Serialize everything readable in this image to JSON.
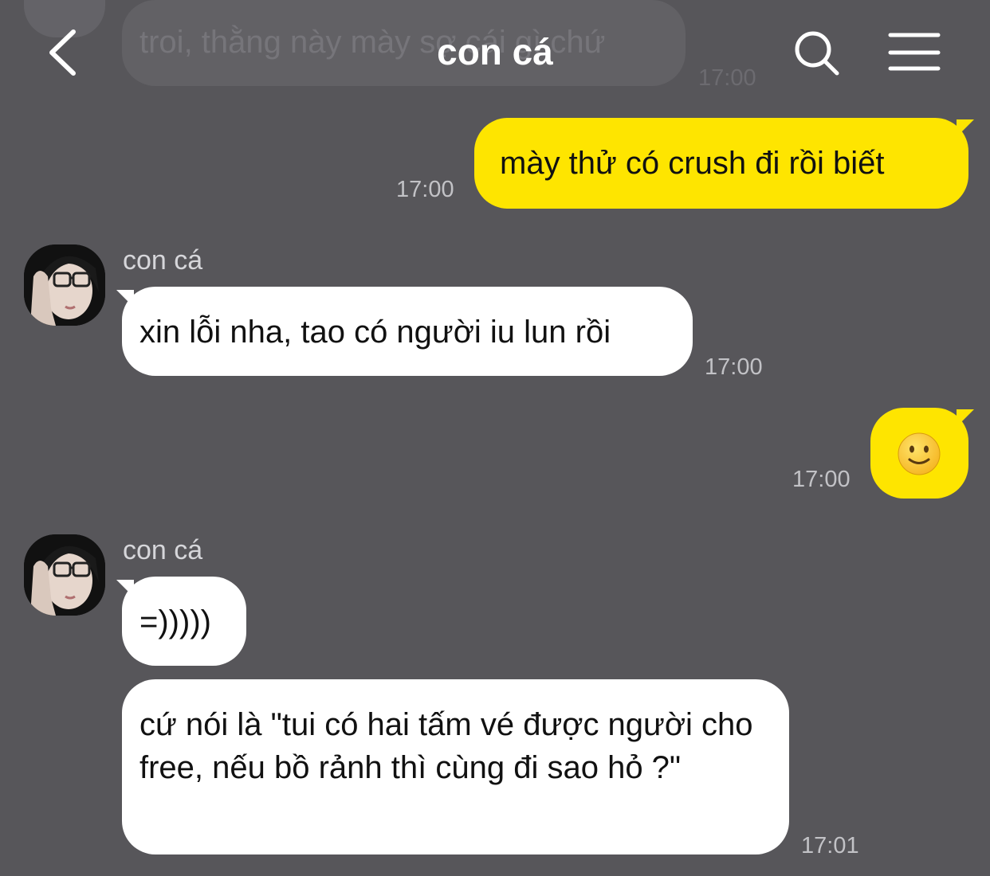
{
  "header": {
    "title": "con cá",
    "back_icon": "chevron-left-icon",
    "search_icon": "search-icon",
    "menu_icon": "hamburger-menu-icon"
  },
  "colors": {
    "background": "#57565a",
    "outgoing_bubble": "#fee500",
    "incoming_bubble": "#ffffff"
  },
  "messages": [
    {
      "direction": "in",
      "faded": true,
      "text": "troi, thằng này mày sợ cái gì chứ",
      "time": "17:00"
    },
    {
      "direction": "out",
      "text": "mày thử có crush đi rồi biết",
      "time": "17:00"
    },
    {
      "direction": "in",
      "sender": "con cá",
      "text": "xin lỗi nha, tao có người iu lun rồi",
      "time": "17:00"
    },
    {
      "direction": "out",
      "text": "🙂",
      "time": "17:00"
    },
    {
      "direction": "in",
      "sender": "con cá",
      "text": "=)))))"
    },
    {
      "direction": "in",
      "text": "cứ nói là \"tui có hai tấm vé được người cho free, nếu bồ rảnh thì cùng đi sao hỏ ?\"",
      "time": "17:01"
    }
  ]
}
